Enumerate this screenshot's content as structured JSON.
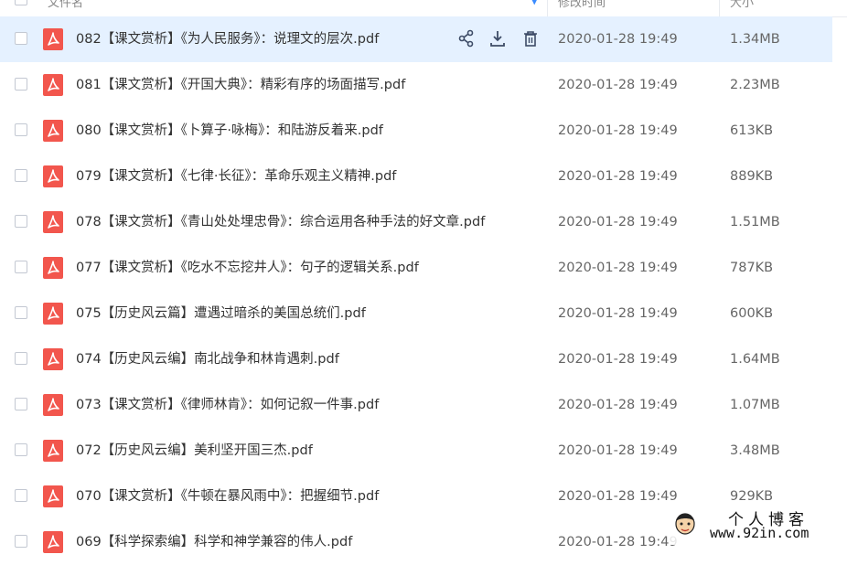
{
  "header": {
    "col_name": "文件名",
    "col_time": "修改时间",
    "col_size": "大小"
  },
  "rows": [
    {
      "name": "082【课文赏析】《为人民服务》：说理文的层次.pdf",
      "time": "2020-01-28 19:49",
      "size": "1.34MB",
      "highlighted": true
    },
    {
      "name": "081【课文赏析】《开国大典》：精彩有序的场面描写.pdf",
      "time": "2020-01-28 19:49",
      "size": "2.23MB"
    },
    {
      "name": "080【课文赏析】《卜算子·咏梅》：和陆游反着来.pdf",
      "time": "2020-01-28 19:49",
      "size": "613KB"
    },
    {
      "name": "079【课文赏析】《七律·长征》：革命乐观主义精神.pdf",
      "time": "2020-01-28 19:49",
      "size": "889KB"
    },
    {
      "name": "078【课文赏析】《青山处处埋忠骨》：综合运用各种手法的好文章.pdf",
      "time": "2020-01-28 19:49",
      "size": "1.51MB"
    },
    {
      "name": "077【课文赏析】《吃水不忘挖井人》：句子的逻辑关系.pdf",
      "time": "2020-01-28 19:49",
      "size": "787KB"
    },
    {
      "name": "075【历史风云篇】遭遇过暗杀的美国总统们.pdf",
      "time": "2020-01-28 19:49",
      "size": "600KB"
    },
    {
      "name": "074【历史风云编】南北战争和林肯遇刺.pdf",
      "time": "2020-01-28 19:49",
      "size": "1.64MB"
    },
    {
      "name": "073【课文赏析】《律师林肯》：如何记叙一件事.pdf",
      "time": "2020-01-28 19:49",
      "size": "1.07MB"
    },
    {
      "name": "072【历史风云编】美利坚开国三杰.pdf",
      "time": "2020-01-28 19:49",
      "size": "3.48MB"
    },
    {
      "name": "070【课文赏析】《牛顿在暴风雨中》：把握细节.pdf",
      "time": "2020-01-28 19:49",
      "size": "929KB"
    },
    {
      "name": "069【科学探索编】科学和神学兼容的伟人.pdf",
      "time": "2020-01-28 19:49",
      "size": ""
    }
  ],
  "row_actions": [
    "share-icon",
    "download-icon",
    "delete-icon"
  ],
  "watermark": {
    "title": "个人博客",
    "url": "www.92in.com"
  },
  "colors": {
    "highlight_row": "#e5f1ff",
    "pdf_icon": "#f2564d",
    "action_icon": "#3d4b66",
    "sort_arrow": "#3b8cff"
  }
}
